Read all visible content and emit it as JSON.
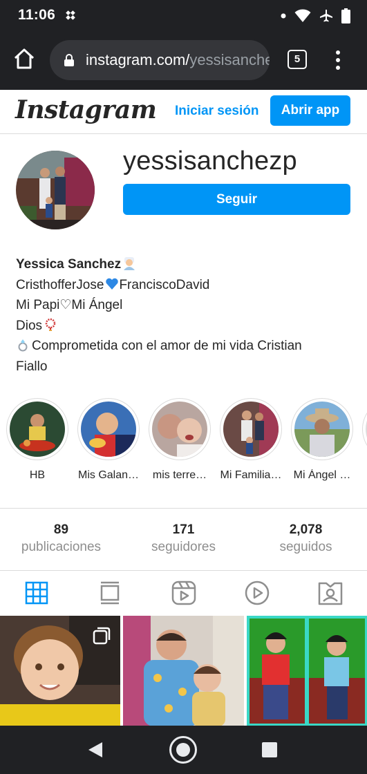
{
  "status_bar": {
    "time": "11:06",
    "battery_level": "98"
  },
  "browser": {
    "url_main": "instagram.com/",
    "url_rest": "yessisanchezp",
    "tab_count": "5"
  },
  "header": {
    "logo": "Instagram",
    "login_label": "Iniciar sesión",
    "open_app_label": "Abrir app"
  },
  "profile": {
    "username": "yessisanchezp",
    "follow_label": "Seguir",
    "full_name": "Yessica Sanchez",
    "bio_line1_a": "CristhofferJose",
    "bio_line1_b": "FranciscoDavid",
    "bio_line2": "Mi Papi♡Mi Ángel",
    "bio_line3": "Dios",
    "bio_line4": "Comprometida con el amor de mi vida Cristian",
    "bio_line5": "Fiallo"
  },
  "highlights": [
    {
      "label": "HB"
    },
    {
      "label": "Mis Galan…"
    },
    {
      "label": "mis terre…"
    },
    {
      "label": "Mi Familia…"
    },
    {
      "label": "Mi Ángel …"
    }
  ],
  "stats": [
    {
      "value": "89",
      "label": "publicaciones"
    },
    {
      "value": "171",
      "label": "seguidores"
    },
    {
      "value": "2,078",
      "label": "seguidos"
    }
  ],
  "colors": {
    "accent": "#0095f6",
    "system_bar": "#202124",
    "border": "#dbdbdb",
    "muted_text": "#8e8e8e"
  },
  "icons": {
    "profile_tabs": [
      "grid-icon",
      "feed-icon",
      "reels-icon",
      "igtv-icon",
      "tagged-icon"
    ]
  }
}
